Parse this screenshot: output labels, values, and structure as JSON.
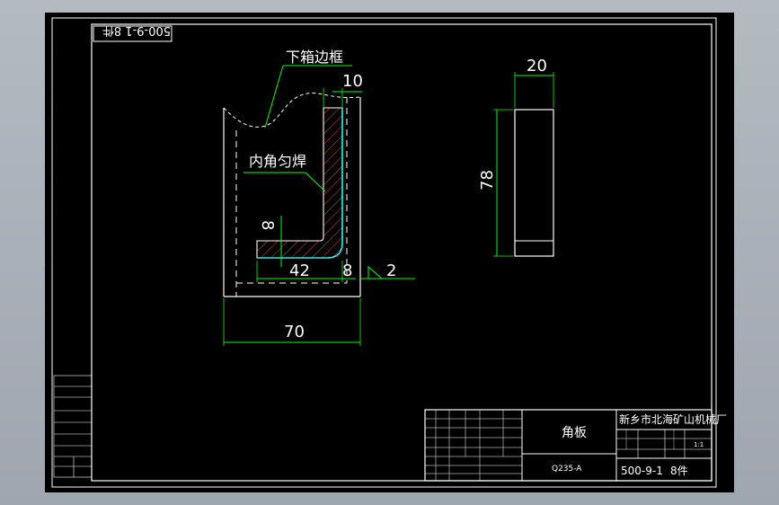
{
  "drawing_number_rotated": "500-9-1 8件",
  "labels": {
    "lower_frame": "下箱边框",
    "weld_note": "内角匀焊"
  },
  "dimensions": {
    "top_thickness": "10",
    "bottom_thickness": "8",
    "vertical_thickness": "8",
    "leg_length": "42",
    "weld_size": "2",
    "overall_width": "70",
    "plate_width": "20",
    "plate_height": "78"
  },
  "title_block": {
    "part_name": "角板",
    "material": "Q235-A",
    "company": "新乡市北海矿山机械厂",
    "drawing_number": "500-9-1",
    "quantity": "8件",
    "scale": "1:1"
  },
  "colors": {
    "background": "#000000",
    "border": "#ffffff",
    "dimension": "#00ff00",
    "part": "#ffffff",
    "weld": "#00ffff"
  }
}
